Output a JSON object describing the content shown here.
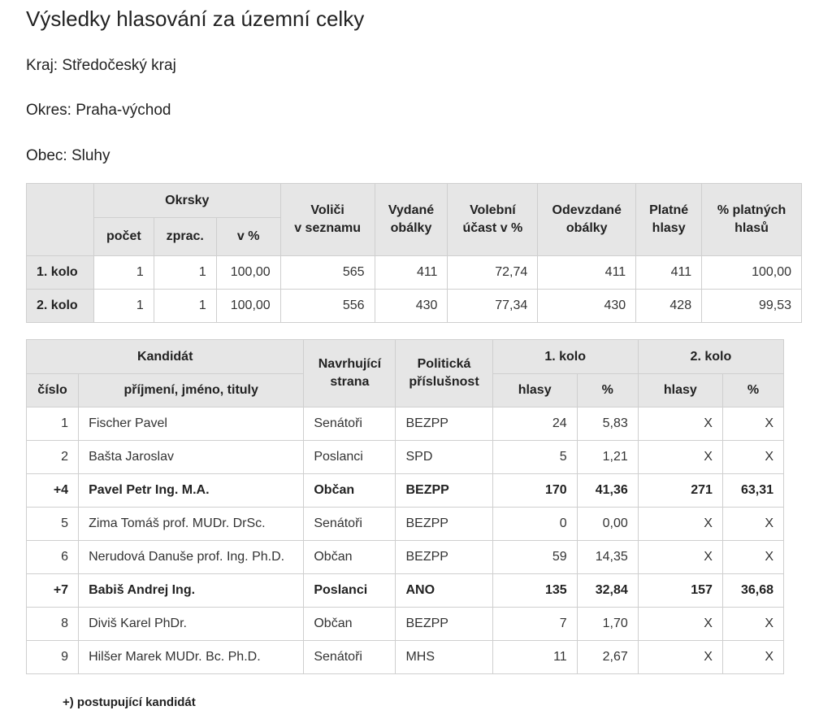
{
  "title": "Výsledky hlasování za územní celky",
  "kraj": "Kraj: Středočeský kraj",
  "okres": "Okres: Praha-východ",
  "obec": "Obec: Sluhy",
  "summary": {
    "headers": {
      "okrsky": "Okrsky",
      "pocet": "počet",
      "zprac": "zprac.",
      "vpct": "v %",
      "volici_1": "Voliči",
      "volici_2": "v seznamu",
      "vydane_1": "Vydané",
      "vydane_2": "obálky",
      "ucast_1": "Volební",
      "ucast_2": "účast v %",
      "odevzdane_1": "Odevzdané",
      "odevzdane_2": "obálky",
      "platne_1": "Platné",
      "platne_2": "hlasy",
      "pctplatnych_1": "% platných",
      "pctplatnych_2": "hlasů"
    },
    "rows": [
      {
        "label": "1. kolo",
        "pocet": "1",
        "zprac": "1",
        "vpct": "100,00",
        "volici": "565",
        "vydane": "411",
        "ucast": "72,74",
        "odevzdane": "411",
        "platne": "411",
        "pctplatnych": "100,00"
      },
      {
        "label": "2. kolo",
        "pocet": "1",
        "zprac": "1",
        "vpct": "100,00",
        "volici": "556",
        "vydane": "430",
        "ucast": "77,34",
        "odevzdane": "430",
        "platne": "428",
        "pctplatnych": "99,53"
      }
    ]
  },
  "candidates": {
    "headers": {
      "kandidat": "Kandidát",
      "cislo": "číslo",
      "jmeno": "příjmení, jméno, tituly",
      "strana_1": "Navrhující",
      "strana_2": "strana",
      "prisl_1": "Politická",
      "prisl_2": "příslušnost",
      "kolo1": "1. kolo",
      "kolo2": "2. kolo",
      "hlasy": "hlasy",
      "pct": "%"
    },
    "rows": [
      {
        "cislo": "1",
        "jmeno": "Fischer Pavel",
        "strana": "Senátoři",
        "prisl": "BEZPP",
        "h1": "24",
        "p1": "5,83",
        "h2": "X",
        "p2": "X",
        "advancing": false
      },
      {
        "cislo": "2",
        "jmeno": "Bašta Jaroslav",
        "strana": "Poslanci",
        "prisl": "SPD",
        "h1": "5",
        "p1": "1,21",
        "h2": "X",
        "p2": "X",
        "advancing": false
      },
      {
        "cislo": "+4",
        "jmeno": "Pavel Petr Ing. M.A.",
        "strana": "Občan",
        "prisl": "BEZPP",
        "h1": "170",
        "p1": "41,36",
        "h2": "271",
        "p2": "63,31",
        "advancing": true
      },
      {
        "cislo": "5",
        "jmeno": "Zima Tomáš prof. MUDr. DrSc.",
        "strana": "Senátoři",
        "prisl": "BEZPP",
        "h1": "0",
        "p1": "0,00",
        "h2": "X",
        "p2": "X",
        "advancing": false
      },
      {
        "cislo": "6",
        "jmeno": "Nerudová Danuše prof. Ing. Ph.D.",
        "strana": "Občan",
        "prisl": "BEZPP",
        "h1": "59",
        "p1": "14,35",
        "h2": "X",
        "p2": "X",
        "advancing": false
      },
      {
        "cislo": "+7",
        "jmeno": "Babiš Andrej Ing.",
        "strana": "Poslanci",
        "prisl": "ANO",
        "h1": "135",
        "p1": "32,84",
        "h2": "157",
        "p2": "36,68",
        "advancing": true
      },
      {
        "cislo": "8",
        "jmeno": "Diviš Karel PhDr.",
        "strana": "Občan",
        "prisl": "BEZPP",
        "h1": "7",
        "p1": "1,70",
        "h2": "X",
        "p2": "X",
        "advancing": false
      },
      {
        "cislo": "9",
        "jmeno": "Hilšer Marek MUDr. Bc. Ph.D.",
        "strana": "Senátoři",
        "prisl": "MHS",
        "h1": "11",
        "p1": "2,67",
        "h2": "X",
        "p2": "X",
        "advancing": false
      }
    ]
  },
  "footnote": "+) postupující kandidát"
}
